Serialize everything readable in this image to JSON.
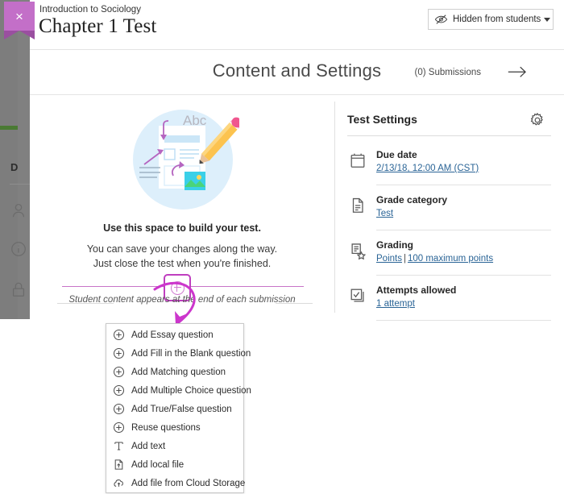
{
  "window": {
    "close_label": "×"
  },
  "header": {
    "course_name": "Introduction to Sociology",
    "title": "Chapter 1 Test",
    "visibility": {
      "icon": "eye-slash-icon",
      "label": "Hidden from students",
      "caret": "chevron-down-icon"
    }
  },
  "subheader": {
    "title": "Content and Settings",
    "submissions_label": "(0) Submissions",
    "arrow_icon": "arrow-right-icon"
  },
  "empty_state": {
    "illustration": "build-test-illustration",
    "heading": "Use this space to build your test.",
    "line1": "You can save your changes along the way.",
    "line2": "Just close the test when you're finished.",
    "add_button_icon": "plus-circle-icon",
    "student_content_note": "Student content appears at the end of each submission",
    "annotation_icon": "hand-drawn-arrow"
  },
  "settings": {
    "title": "Test Settings",
    "gear_icon": "gear-icon",
    "rows": [
      {
        "icon": "calendar-icon",
        "label": "Due date",
        "value": "2/13/18, 12:00 AM (CST)"
      },
      {
        "icon": "document-icon",
        "label": "Grade category",
        "value": "Test"
      },
      {
        "icon": "grading-icon",
        "label": "Grading",
        "value": "Points",
        "separator": "|",
        "value2": "100 maximum points"
      },
      {
        "icon": "attempts-icon",
        "label": "Attempts allowed",
        "value": "1 attempt"
      }
    ]
  },
  "add_menu": {
    "items": [
      {
        "icon": "plus-circle-icon",
        "label": "Add Essay question"
      },
      {
        "icon": "plus-circle-icon",
        "label": "Add Fill in the Blank question"
      },
      {
        "icon": "plus-circle-icon",
        "label": "Add Matching question"
      },
      {
        "icon": "plus-circle-icon",
        "label": "Add Multiple Choice question"
      },
      {
        "icon": "plus-circle-icon",
        "label": "Add True/False question"
      },
      {
        "icon": "plus-circle-icon",
        "label": "Reuse questions"
      },
      {
        "icon": "text-tool-icon",
        "label": "Add text"
      },
      {
        "icon": "upload-file-icon",
        "label": "Add local file"
      },
      {
        "icon": "cloud-upload-icon",
        "label": "Add file from Cloud Storage"
      }
    ]
  },
  "background_sidebar": {
    "ghost_letter": "D",
    "icons": [
      "person-icon",
      "info-circle-icon",
      "lock-icon"
    ]
  },
  "colors": {
    "accent_purple": "#bf3ebf",
    "tag_purple": "#c36fc8",
    "tag_purple_dark": "#9a4fa0",
    "link_blue": "#2a6496",
    "sidebar_green": "#4a7a33",
    "overlay_grey": "#7d7d7d"
  }
}
